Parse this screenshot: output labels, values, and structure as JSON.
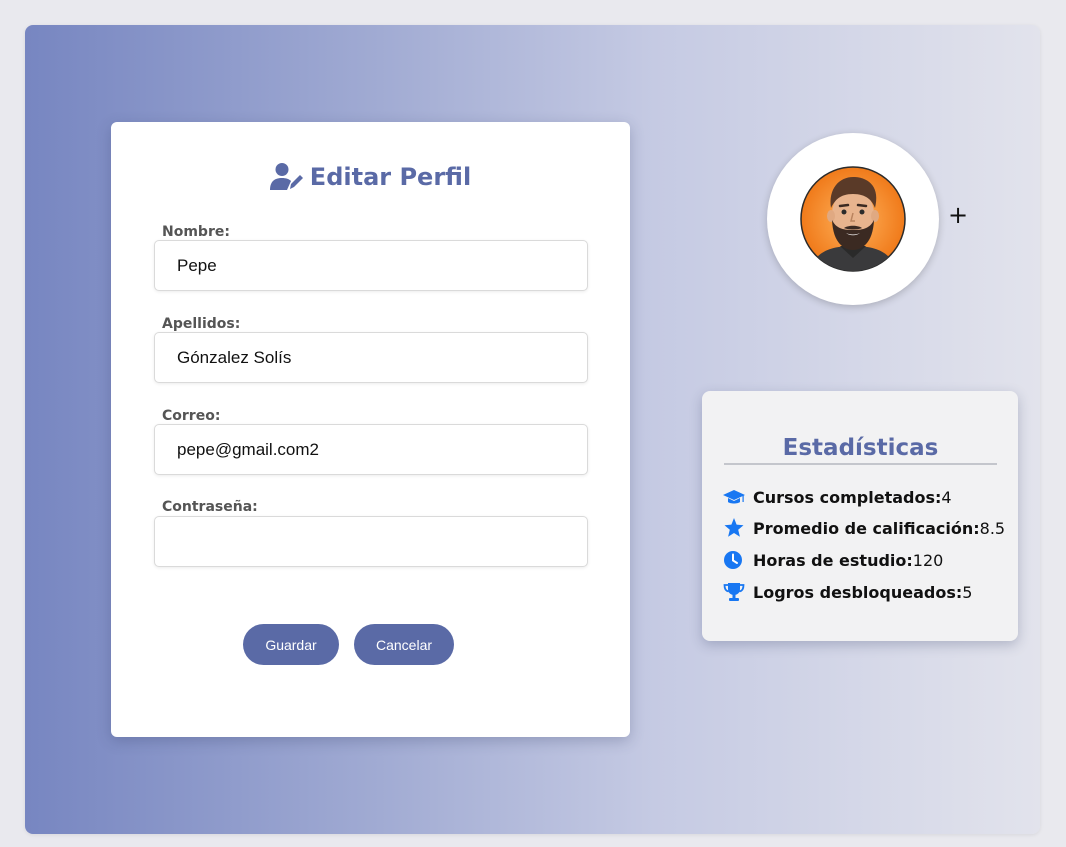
{
  "form": {
    "title": "Editar Perfil",
    "fields": [
      {
        "label": "Nombre:",
        "value": "Pepe"
      },
      {
        "label": "Apellidos:",
        "value": "Gónzalez Solís"
      },
      {
        "label": "Correo:",
        "value": "pepe@gmail.com2"
      },
      {
        "label": "Contraseña:",
        "value": ""
      }
    ],
    "save_label": "Guardar",
    "cancel_label": "Cancelar"
  },
  "avatar": {
    "add_label": "+"
  },
  "stats": {
    "title": "Estadísticas",
    "items": [
      {
        "icon": "graduation-cap-icon",
        "label": "Cursos completados:",
        "value": "4"
      },
      {
        "icon": "star-icon",
        "label": "Promedio de calificación:",
        "value": "8.5"
      },
      {
        "icon": "clock-icon",
        "label": "Horas de estudio:",
        "value": "120"
      },
      {
        "icon": "trophy-icon",
        "label": "Logros desbloqueados:",
        "value": "5"
      }
    ]
  },
  "colors": {
    "accent": "#5a6aa6",
    "icon_blue": "#1877f2"
  }
}
